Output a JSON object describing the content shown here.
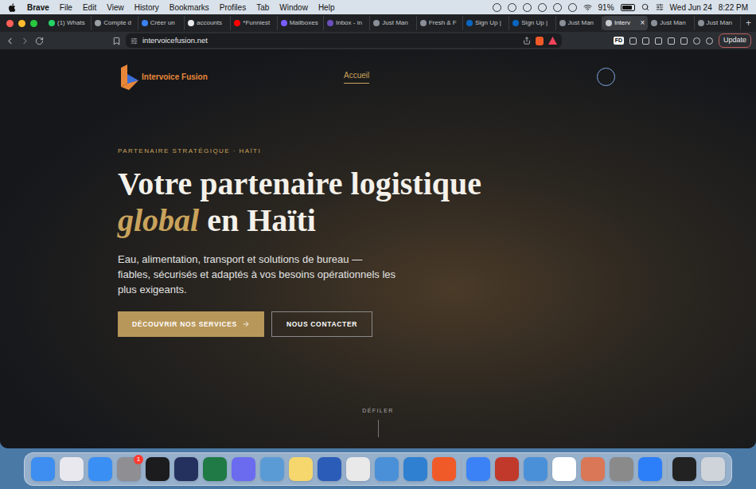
{
  "menu_bar": {
    "app": "Brave",
    "items": [
      "File",
      "Edit",
      "View",
      "History",
      "Bookmarks",
      "Profiles",
      "Tab",
      "Window",
      "Help"
    ],
    "battery": "91%",
    "battery_level": 0.91,
    "date": "Wed Jun 24",
    "time": "8:22 PM"
  },
  "tabs": [
    {
      "label": "(1) Whats",
      "selected": false,
      "color": "#25d366"
    },
    {
      "label": "Compte d",
      "selected": false,
      "color": "#9aa0a6"
    },
    {
      "label": "Créer un",
      "selected": false,
      "color": "#3b82f6"
    },
    {
      "label": "accounts",
      "selected": false,
      "color": "#e8eaed"
    },
    {
      "label": "*Funniest",
      "selected": false,
      "color": "#ff0000"
    },
    {
      "label": "Mailboxes",
      "selected": false,
      "color": "#7b5cff"
    },
    {
      "label": "Inbox - in",
      "selected": false,
      "color": "#6b4fbb"
    },
    {
      "label": "Just Man",
      "selected": false,
      "color": "#8a8f98"
    },
    {
      "label": "Fresh & F",
      "selected": false,
      "color": "#8a8f98"
    },
    {
      "label": "Sign Up |",
      "selected": false,
      "color": "#0a66c2"
    },
    {
      "label": "Sign Up |",
      "selected": false,
      "color": "#0a66c2"
    },
    {
      "label": "Just Man",
      "selected": false,
      "color": "#8a8f98"
    },
    {
      "label": "Interv",
      "selected": true,
      "color": "#c7c9cc"
    },
    {
      "label": "Just Man",
      "selected": false,
      "color": "#8a8f98"
    },
    {
      "label": "Just Man",
      "selected": false,
      "color": "#8a8f98"
    }
  ],
  "tab_strip": {
    "close": "×",
    "new_tab": "+"
  },
  "toolbar": {
    "url": "intervoicefusion.net",
    "extension_badge": "FD",
    "update_button": "Update"
  },
  "page": {
    "logo": "Intervoice Fusion",
    "nav": [
      {
        "label": "Accueil",
        "selected": true
      }
    ],
    "eyebrow": "PARTENAIRE STRATÉGIQUE · HAÏTI",
    "heading_line1": "Votre partenaire logistique",
    "heading_accent": "global",
    "heading_rest": "en Haïti",
    "paragraph": "Eau, alimentation, transport et solutions de bureau — fiables, sécurisés et adaptés à vos besoins opérationnels les plus exigeants.",
    "primary_button": "DÉCOUVRIR NOS SERVICES",
    "secondary_button": "NOUS CONTACTER",
    "scroll_hint": "DÉFILER"
  },
  "dock": [
    {
      "kind": "app",
      "color": "#3d8ef0",
      "badge": ""
    },
    {
      "kind": "app",
      "color": "#e8e8ee",
      "badge": ""
    },
    {
      "kind": "app",
      "color": "#3a8ff5",
      "badge": ""
    },
    {
      "kind": "app",
      "color": "#8e8e93",
      "badge": "1"
    },
    {
      "kind": "app",
      "color": "#1c1c1e",
      "badge": ""
    },
    {
      "kind": "app",
      "color": "#24305e",
      "badge": ""
    },
    {
      "kind": "app",
      "color": "#1f7a45",
      "badge": ""
    },
    {
      "kind": "app",
      "color": "#6b6bf0",
      "badge": ""
    },
    {
      "kind": "app",
      "color": "#5b9bd5",
      "badge": ""
    },
    {
      "kind": "app",
      "color": "#f5d76e",
      "badge": ""
    },
    {
      "kind": "app",
      "color": "#2b5cb8",
      "badge": ""
    },
    {
      "kind": "app",
      "color": "#e9e9e9",
      "badge": ""
    },
    {
      "kind": "app",
      "color": "#4a90d9",
      "badge": ""
    },
    {
      "kind": "app",
      "color": "#2f80d1",
      "badge": ""
    },
    {
      "kind": "app",
      "color": "#f05a28",
      "badge": ""
    },
    {
      "kind": "separator",
      "color": "#9aa5b1",
      "badge": ""
    },
    {
      "kind": "app",
      "color": "#3b82f6",
      "badge": ""
    },
    {
      "kind": "app",
      "color": "#c0392b",
      "badge": ""
    },
    {
      "kind": "app",
      "color": "#4a90d9",
      "badge": ""
    },
    {
      "kind": "app",
      "color": "#ffffff",
      "badge": ""
    },
    {
      "kind": "app",
      "color": "#d97757",
      "badge": ""
    },
    {
      "kind": "app",
      "color": "#8a8a8a",
      "badge": ""
    },
    {
      "kind": "app",
      "color": "#2d7ff9",
      "badge": ""
    },
    {
      "kind": "separator",
      "color": "#9aa5b1",
      "badge": ""
    },
    {
      "kind": "app",
      "color": "#222222",
      "badge": ""
    },
    {
      "kind": "app",
      "color": "#cfd4da",
      "badge": ""
    }
  ]
}
